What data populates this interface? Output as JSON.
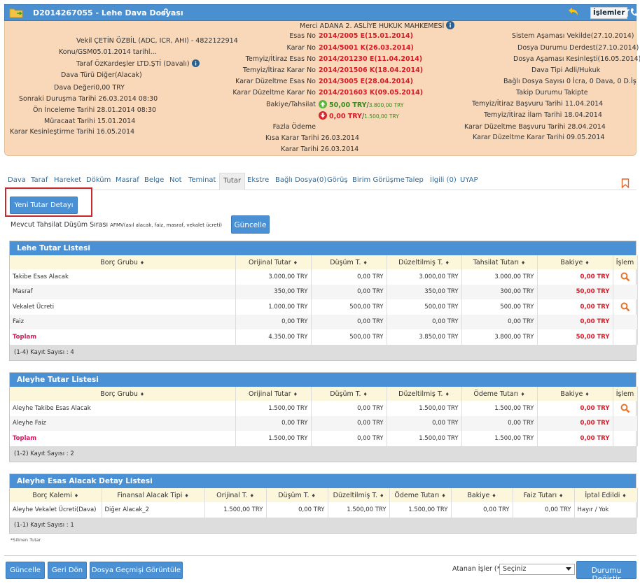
{
  "header": {
    "title": "D2014267055 - Lehe Dava Dosyası",
    "islemler_label": "İşlemler",
    "accent": "#4a8fd0"
  },
  "info": {
    "col1": [
      {
        "label": "Vekil",
        "value": "ÇETİN ÖZBİL (ADC, ICR, AHI) - 4822122914"
      },
      {
        "label": "Konu/GSM",
        "value": "05.01.2014 tarihl..."
      },
      {
        "label": "Taraf",
        "value": "ÖzKardeşler LTD.ŞTİ  (Davalı)"
      },
      {
        "label": "Dava Türü",
        "value": "Diğer(Alacak)"
      },
      {
        "label": "Dava Değeri",
        "value": "0,00 TRY"
      },
      {
        "label": "Sonraki Duruşma Tarihi",
        "value": "26.03.2014 08:30"
      },
      {
        "label": "Ön İnceleme Tarihi",
        "value": "28.01.2014 08:30"
      },
      {
        "label": "Müracaat Tarihi",
        "value": "15.01.2014"
      },
      {
        "label": "Karar Kesinleştirme Tarihi",
        "value": "16.05.2014"
      }
    ],
    "col2": {
      "merci_label": "Merci",
      "merci_value": "ADANA 2. ASLİYE HUKUK MAHKEMESİ",
      "rows": [
        {
          "label": "Esas No",
          "value": "2014/2005 E(15.01.2014)"
        },
        {
          "label": "Karar No",
          "value": "2014/5001 K(26.03.2014)"
        },
        {
          "label": "Temyiz/İtiraz Esas No",
          "value": "2014/201230 E(11.04.2014)"
        },
        {
          "label": "Temyiz/İtiraz Karar No",
          "value": "2014/201506 K(18.04.2014)"
        },
        {
          "label": "Karar Düzeltme Esas No",
          "value": "2014/3005 E(28.04.2014)"
        },
        {
          "label": "Karar Düzeltme Karar No",
          "value": "2014/201603 K(09.05.2014)"
        }
      ],
      "bakiye_label": "Bakiye/Tahsilat",
      "bakiye1_main": "50,00 TRY",
      "bakiye1_sub": "3.800,00 TRY",
      "bakiye2_main": "0,00 TRY",
      "bakiye2_sub": "1.500,00 TRY",
      "fazla_label": "Fazla Ödeme",
      "kisa_label": "Kısa Karar Tarihi",
      "kisa_value": "26.03.2014",
      "karar_label": "Karar Tarihi",
      "karar_value": "26.03.2014"
    },
    "col3": [
      {
        "label": "Sistem Aşaması",
        "value": "Vekilde(27.10.2014)"
      },
      {
        "label": "Dosya Durumu",
        "value": "Derdest(27.10.2014)"
      },
      {
        "label": "Dosya Aşaması",
        "value": "Kesinleşti(16.05.2014)"
      },
      {
        "label": "Dava Tipi",
        "value": "Adli/Hukuk"
      },
      {
        "label": "Bağlı Dosya Sayısı",
        "value": "0 İcra, 0 Dava, 0 D.İş"
      },
      {
        "label": "Takip Durumu",
        "value": "Takipte"
      },
      {
        "label": "Temyiz/İtiraz Başvuru Tarihi",
        "value": "11.04.2014"
      },
      {
        "label": "Temyiz/İtiraz İlam Tarihi",
        "value": "18.04.2014"
      },
      {
        "label": "Karar Düzeltme Başvuru Tarihi",
        "value": "28.04.2014"
      },
      {
        "label": "Karar Düzeltme Karar Tarihi",
        "value": "09.05.2014"
      }
    ]
  },
  "tabs": [
    "Dava",
    "Taraf",
    "Hareket",
    "Döküm",
    "Masraf",
    "Belge",
    "Not",
    "Teminat",
    "Tutar",
    "Ekstre",
    "Bağlı Dosya(0)",
    "Görüş",
    "Birim Görüşme",
    "Talep",
    "İlgili (0)",
    "UYAP"
  ],
  "active_tab": "Tutar",
  "yeni_button": "Yeni Tutar Detayı",
  "mevcut_label": "Mevcut Tahsilat Düşüm Sırası",
  "mevcut_code": "AFMV",
  "mevcut_desc": "(asıl alacak, faiz, masraf, vekalet ücreti)",
  "guncelle_label": "Güncelle",
  "lehe": {
    "title": "Lehe Tutar Listesi",
    "headers": [
      "Borç Grubu",
      "Orijinal Tutar",
      "Düşüm T.",
      "Düzeltilmiş T.",
      "Tahsilat Tutarı",
      "Bakiye",
      "İşlem"
    ],
    "rows": [
      [
        "Takibe Esas Alacak",
        "3.000,00 TRY",
        "0,00 TRY",
        "3.000,00 TRY",
        "3.000,00 TRY",
        "0,00 TRY"
      ],
      [
        "Masraf",
        "350,00 TRY",
        "0,00 TRY",
        "350,00 TRY",
        "300,00 TRY",
        "50,00 TRY"
      ],
      [
        "Vekalet Ücreti",
        "1.000,00 TRY",
        "500,00 TRY",
        "500,00 TRY",
        "500,00 TRY",
        "0,00 TRY"
      ],
      [
        "Faiz",
        "0,00 TRY",
        "0,00 TRY",
        "0,00 TRY",
        "0,00 TRY",
        "0,00 TRY"
      ]
    ],
    "total": [
      "Toplam",
      "4.350,00 TRY",
      "500,00 TRY",
      "3.850,00 TRY",
      "3.800,00 TRY",
      "50,00 TRY"
    ],
    "footer": "(1-4) Kayıt Sayısı : 4"
  },
  "aleyhe": {
    "title": "Aleyhe Tutar Listesi",
    "headers": [
      "Borç Grubu",
      "Orijinal Tutar",
      "Düşüm T.",
      "Düzeltilmiş T.",
      "Ödeme Tutarı",
      "Bakiye",
      "İşlem"
    ],
    "rows": [
      [
        "Aleyhe Takibe Esas Alacak",
        "1.500,00 TRY",
        "0,00 TRY",
        "1.500,00 TRY",
        "1.500,00 TRY",
        "0,00 TRY"
      ],
      [
        "Aleyhe Faiz",
        "0,00 TRY",
        "0,00 TRY",
        "0,00 TRY",
        "0,00 TRY",
        "0,00 TRY"
      ]
    ],
    "total": [
      "Toplam",
      "1.500,00 TRY",
      "0,00 TRY",
      "1.500,00 TRY",
      "1.500,00 TRY",
      "0,00 TRY"
    ],
    "footer": "(1-2) Kayıt Sayısı : 2"
  },
  "detay": {
    "title": "Aleyhe Esas Alacak Detay Listesi",
    "headers": [
      "Borç Kalemi",
      "Finansal Alacak Tipi",
      "Orijinal T.",
      "Düşüm T.",
      "Düzeltilmiş T.",
      "Ödeme Tutarı",
      "Bakiye",
      "Faiz Tutarı",
      "İptal Edildi"
    ],
    "rows": [
      [
        "Aleyhe Vekalet Ücreti(Dava)",
        "Diğer Alacak_2",
        "1.500,00 TRY",
        "0,00 TRY",
        "1.500,00 TRY",
        "1.500,00 TRY",
        "0,00 TRY",
        "0,00 TRY",
        "Hayır / Yok"
      ]
    ],
    "footer": "(1-1) Kayıt Sayısı : 1"
  },
  "silinen_note": "*Silinen Tutar",
  "bottom": {
    "guncelle": "Güncelle",
    "geri_don": "Geri Dön",
    "gecmis": "Dosya Geçmişi Görüntüle",
    "atanan_label": "Atanan İşler (*)",
    "select_value": "Seçiniz",
    "durumu_degistir": "Durumu Değiştir"
  }
}
